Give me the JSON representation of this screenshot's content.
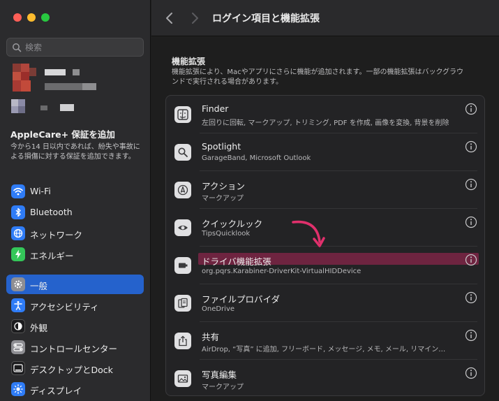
{
  "sidebar": {
    "search_placeholder": "検索",
    "applecare": {
      "title": "AppleCare+ 保証を追加",
      "description": "今から14 日以内であれば、紛失や事故による損傷に対する保証を追加できます。"
    },
    "items": [
      {
        "label": "Wi-Fi",
        "icon": "wifi-icon",
        "color": "#2f7cf6"
      },
      {
        "label": "Bluetooth",
        "icon": "bluetooth-icon",
        "color": "#2f7cf6"
      },
      {
        "label": "ネットワーク",
        "icon": "globe-icon",
        "color": "#2f7cf6"
      },
      {
        "label": "エネルギー",
        "icon": "bolt-icon",
        "color": "#34c759"
      },
      {
        "label": "一般",
        "icon": "gear-icon",
        "color": "#8e8e93",
        "selected": true
      },
      {
        "label": "アクセシビリティ",
        "icon": "accessibility-icon",
        "color": "#2f7cf6"
      },
      {
        "label": "外観",
        "icon": "appearance-icon",
        "color": "#1c1c1e"
      },
      {
        "label": "コントロールセンター",
        "icon": "control-center-icon",
        "color": "#8e8e93"
      },
      {
        "label": "デスクトップとDock",
        "icon": "desktop-dock-icon",
        "color": "#1c1c1e"
      },
      {
        "label": "ディスプレイ",
        "icon": "display-icon",
        "color": "#2f7cf6"
      }
    ]
  },
  "header": {
    "title": "ログイン項目と機能拡張"
  },
  "main": {
    "section_title": "機能拡張",
    "section_description": "機能拡張により、Macやアプリにさらに機能が追加されます。一部の機能拡張はバックグラウンドで実行される場合があります。",
    "extensions": [
      {
        "name": "Finder",
        "subtitle": "左回りに回転, マークアップ, トリミング, PDF を作成, 画像を変換, 背景を削除",
        "icon": "finder-icon"
      },
      {
        "name": "Spotlight",
        "subtitle": "GarageBand, Microsoft Outlook",
        "icon": "magnifier-icon"
      },
      {
        "name": "アクション",
        "subtitle": "マークアップ",
        "icon": "markup-icon"
      },
      {
        "name": "クイックルック",
        "subtitle": "TipsQuicklook",
        "icon": "eye-icon"
      },
      {
        "name": "ドライバ機能拡張",
        "subtitle": "org.pqrs.Karabiner-DriverKit-VirtualHIDDevice",
        "icon": "driver-icon",
        "highlighted": true
      },
      {
        "name": "ファイルプロバイダ",
        "subtitle": "OneDrive",
        "icon": "documents-icon"
      },
      {
        "name": "共有",
        "subtitle": "AirDrop, “写真” に追加, フリーボード, メッセージ, メモ, メール, リマイン…",
        "icon": "share-icon"
      },
      {
        "name": "写真編集",
        "subtitle": "マークアップ",
        "icon": "photo-icon"
      }
    ],
    "highlight_color": "#6e2440",
    "arrow_color": "#e0306c"
  }
}
